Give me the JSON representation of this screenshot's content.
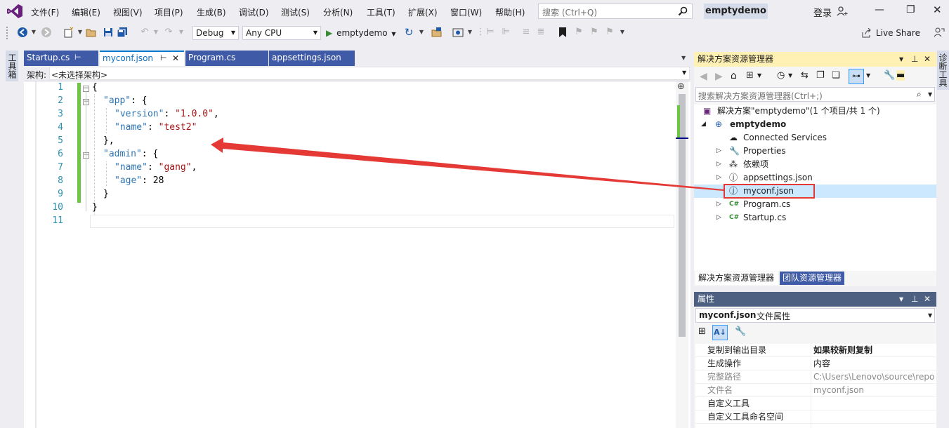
{
  "menu": {
    "items": [
      "文件(F)",
      "编辑(E)",
      "视图(V)",
      "项目(P)",
      "生成(B)",
      "调试(D)",
      "测试(S)",
      "分析(N)",
      "工具(T)",
      "扩展(X)",
      "窗口(W)",
      "帮助(H)"
    ],
    "search_placeholder": "搜索 (Ctrl+Q)",
    "solution_name": "emptydemo",
    "login": "登录"
  },
  "toolbar": {
    "config": "Debug",
    "platform": "Any CPU",
    "run_target": "emptydemo",
    "live_share": "Live Share"
  },
  "side_tabs": {
    "left": "工具箱",
    "right": "诊断工具"
  },
  "tabs": [
    {
      "label": "Startup.cs",
      "pin": "⊢",
      "active": false
    },
    {
      "label": "myconf.json",
      "pin": "⊢",
      "active": true
    },
    {
      "label": "Program.cs",
      "active": false
    },
    {
      "label": "appsettings.json",
      "active": false
    }
  ],
  "navbar": {
    "label": "架构:",
    "value": "<未选择架构>"
  },
  "editor": {
    "lines": [
      "1",
      "2",
      "3",
      "4",
      "5",
      "6",
      "7",
      "8",
      "9",
      "10",
      "11"
    ],
    "code": {
      "l1": "{",
      "l2_key": "\"app\"",
      "l2_rest": ": {",
      "l3_key": "\"version\"",
      "l3_colon": ": ",
      "l3_val": "\"1.0.0\"",
      "l3_end": ",",
      "l4_key": "\"name\"",
      "l4_colon": ": ",
      "l4_val": "\"test2\"",
      "l5": "},",
      "l6_key": "\"admin\"",
      "l6_rest": ": {",
      "l7_key": "\"name\"",
      "l7_colon": ": ",
      "l7_val": "\"gang\"",
      "l7_end": ",",
      "l8_key": "\"age\"",
      "l8_colon": ": ",
      "l8_val": "28",
      "l9": "}",
      "l10": "}"
    }
  },
  "solution_explorer": {
    "title": "解决方案资源管理器",
    "search_placeholder": "搜索解决方案资源管理器(Ctrl+;)",
    "solution": "解决方案\"emptydemo\"(1 个项目/共 1 个)",
    "project": "emptydemo",
    "items": [
      {
        "label": "Connected Services"
      },
      {
        "label": "Properties"
      },
      {
        "label": "依赖项"
      },
      {
        "label": "appsettings.json"
      },
      {
        "label": "myconf.json"
      },
      {
        "label": "Program.cs"
      },
      {
        "label": "Startup.cs"
      }
    ],
    "bottom_tabs": [
      "解决方案资源管理器",
      "团队资源管理器"
    ]
  },
  "properties": {
    "title": "属性",
    "object_name": "myconf.json",
    "object_type": "文件属性",
    "rows": [
      {
        "name": "复制到输出目录",
        "value": "如果较新则复制"
      },
      {
        "name": "生成操作",
        "value": "内容"
      },
      {
        "name": "完整路径",
        "value": "C:\\Users\\Lenovo\\source\\repo"
      },
      {
        "name": "文件名",
        "value": "myconf.json"
      },
      {
        "name": "自定义工具",
        "value": ""
      },
      {
        "name": "自定义工具命名空间",
        "value": ""
      }
    ]
  },
  "colors": {
    "accent": "#007acc",
    "vs_purple": "#68217a",
    "tab_bar": "#3f5aa6",
    "annotation": "#e53935"
  }
}
